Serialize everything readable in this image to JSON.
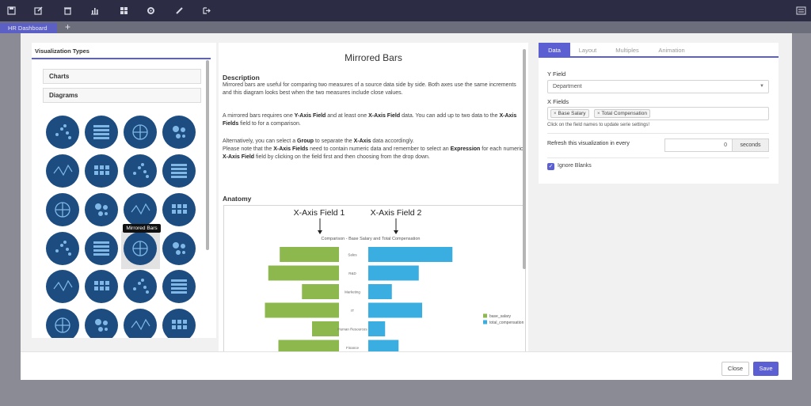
{
  "toolbar": {
    "icons": [
      "save-icon",
      "edit-icon",
      "trash-icon",
      "bar-chart-icon",
      "dashboard-icon",
      "gear-icon",
      "brush-icon",
      "exit-icon",
      "menu-icon"
    ]
  },
  "tabs_bar": {
    "active_tab": "HR Dashboard",
    "add_label": "+"
  },
  "left_panel": {
    "title": "Visualization Types",
    "sections": [
      "Charts",
      "Diagrams"
    ],
    "tooltip": "Mirrored Bars"
  },
  "middle": {
    "title": "Mirrored Bars",
    "description_heading": "Description",
    "anatomy_heading": "Anatomy",
    "p1": "Mirrored bars are useful for comparing two measures of a source data side by side. Both axes use the same increments and this diagram looks best when the two measures include close values.",
    "p2a": "A mirrored bars requires one ",
    "p2b": "Y-Axis Field",
    "p2c": " and at least one ",
    "p2d": "X-Axis Field",
    "p2e": " data. You can add up to two data to the ",
    "p2f": "X-Axis Fields",
    "p2g": " field to for a comparison.",
    "p3a": "Alternatively, you can select a ",
    "p3b": "Group",
    "p3c": " to separate the ",
    "p3d": "X-Axis",
    "p3e": " data accordingly.",
    "p4a": "Please note that the ",
    "p4b": "X-Axis Fields",
    "p4c": " need to contain numeric data and remember to select an ",
    "p4d": "Expression",
    "p4e": " for each numeric ",
    "p4f": "X-Axis Field",
    "p4g": " field by clicking on the field first and then choosing from the drop down."
  },
  "chart_data": {
    "type": "bar",
    "title": "Comparison - Base Salary and Total Compensation",
    "annotations": [
      "X-Axis Field 1",
      "X-Axis Field 2"
    ],
    "categories": [
      "Sales",
      "R&D",
      "Marketing",
      "IT",
      "Human Resources",
      "Finance"
    ],
    "series": [
      {
        "name": "base_salary",
        "color": "#8cb84d",
        "values": [
          88,
          105,
          55,
          110,
          40,
          90
        ]
      },
      {
        "name": "total_compensation",
        "color": "#3aaee0",
        "values": [
          125,
          75,
          35,
          80,
          25,
          45
        ]
      }
    ],
    "legend_position": "right"
  },
  "right_panel": {
    "tabs": [
      "Data",
      "Layout",
      "Multiples",
      "Animation"
    ],
    "active_tab": "Data",
    "y_field_label": "Y Field",
    "y_field_value": "Department",
    "x_fields_label": "X Fields",
    "x_fields": [
      "Base Salary",
      "Total Compensation"
    ],
    "tag_remove": "×",
    "hint": "Click on the field names to update serie settings!",
    "refresh_label": "Refresh this visualization in every",
    "refresh_value": "0",
    "refresh_unit": "seconds",
    "ignore_blanks_label": "Ignore Blanks",
    "ignore_blanks_checked": true
  },
  "footer": {
    "close_label": "Close",
    "save_label": "Save"
  }
}
